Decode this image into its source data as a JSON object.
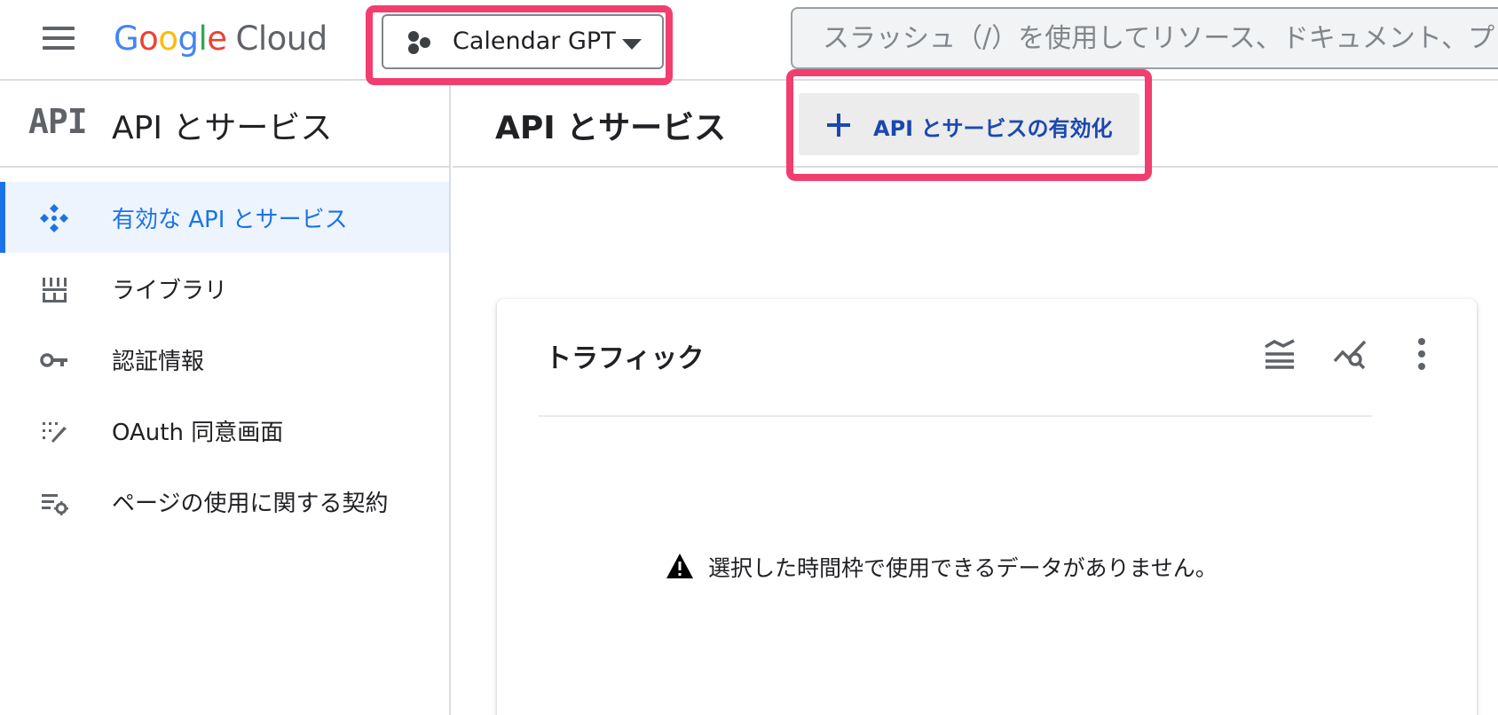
{
  "header": {
    "logo_parts": [
      "G",
      "o",
      "o",
      "g",
      "l",
      "e"
    ],
    "logo_cloud": "Cloud",
    "project_name": "Calendar GPT",
    "search_placeholder": "スラッシュ（/）を使用してリソース、ドキュメント、プ"
  },
  "sidebar": {
    "badge": "API",
    "title": "API とサービス",
    "items": [
      {
        "label": "有効な API とサービス",
        "icon": "enabled-apis-icon",
        "active": true
      },
      {
        "label": "ライブラリ",
        "icon": "library-icon",
        "active": false
      },
      {
        "label": "認証情報",
        "icon": "key-icon",
        "active": false
      },
      {
        "label": "OAuth 同意画面",
        "icon": "oauth-consent-icon",
        "active": false
      },
      {
        "label": "ページの使用に関する契約",
        "icon": "page-usage-agreement-icon",
        "active": false
      }
    ]
  },
  "main": {
    "title": "API とサービス",
    "enable_button_label": "API とサービスの有効化",
    "card": {
      "title": "トラフィック",
      "empty_message": "選択した時間枠で使用できるデータがありません。",
      "tools": [
        "legend-icon",
        "compare-icon",
        "more-vert-icon"
      ]
    }
  },
  "colors": {
    "accent": "#1a73e8",
    "highlight": "#f23e6e",
    "active_bg": "#eef4fe",
    "button_text": "#1a48b0",
    "button_bg": "#ececec"
  }
}
